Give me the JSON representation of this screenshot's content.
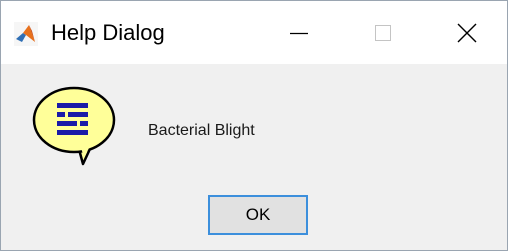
{
  "window": {
    "title": "Help Dialog",
    "controls": {
      "minimize_icon": "minimize-icon",
      "maximize_icon": "maximize-icon",
      "close_icon": "close-icon"
    }
  },
  "dialog": {
    "icon": "help-speech-bubble-icon",
    "message": "Bacterial Blight",
    "ok_label": "OK"
  },
  "colors": {
    "titlebar_bg": "#ffffff",
    "client_bg": "#f0f0f0",
    "button_focus_border": "#3c8fdc",
    "help_icon_fill": "#ffff99",
    "help_icon_lines": "#1a1aa8"
  }
}
